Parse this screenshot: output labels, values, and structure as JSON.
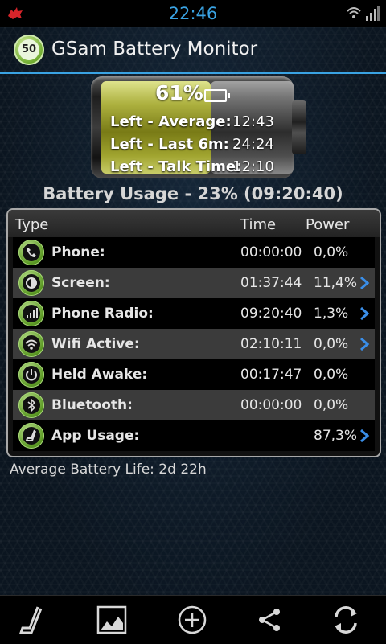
{
  "status_bar": {
    "time": "22:46"
  },
  "app": {
    "title": "GSam Battery Monitor",
    "badge": "50"
  },
  "battery": {
    "percent_text": "61%",
    "level": 0.61,
    "rows": [
      {
        "label": "Left - Average:",
        "value": "12:43"
      },
      {
        "label": "Left - Last 6m:",
        "value": "24:24"
      },
      {
        "label": "Left - Talk Time:",
        "value": "12:10"
      }
    ]
  },
  "usage": {
    "title": "Battery Usage - 23% (09:20:40)"
  },
  "table": {
    "headers": {
      "type": "Type",
      "time": "Time",
      "power": "Power"
    },
    "rows": [
      {
        "icon": "phone-icon",
        "label": "Phone:",
        "time": "00:00:00",
        "power": "0,0%",
        "chevron": false
      },
      {
        "icon": "screen-icon",
        "label": "Screen:",
        "time": "01:37:44",
        "power": "11,4%",
        "chevron": true
      },
      {
        "icon": "signal-icon",
        "label": "Phone Radio:",
        "time": "09:20:40",
        "power": "1,3%",
        "chevron": true
      },
      {
        "icon": "wifi-icon",
        "label": "Wifi Active:",
        "time": "02:10:11",
        "power": "0,0%",
        "chevron": true
      },
      {
        "icon": "power-icon",
        "label": "Held Awake:",
        "time": "00:17:47",
        "power": "0,0%",
        "chevron": false
      },
      {
        "icon": "bluetooth-icon",
        "label": "Bluetooth:",
        "time": "00:00:00",
        "power": "0,0%",
        "chevron": false
      },
      {
        "icon": "app-usage-icon",
        "label": "App Usage:",
        "time": "",
        "power": "87,3%",
        "chevron": true
      }
    ]
  },
  "footer": {
    "avg_life": "Average Battery Life: 2d 22h"
  },
  "bottom_bar": {
    "buttons": [
      "app-usage-icon",
      "graph-icon",
      "add-icon",
      "share-icon",
      "refresh-icon"
    ]
  },
  "colors": {
    "accent": "#3aa3e3",
    "battery_fill": "#b4b840",
    "chevron": "#3a8ee8"
  }
}
